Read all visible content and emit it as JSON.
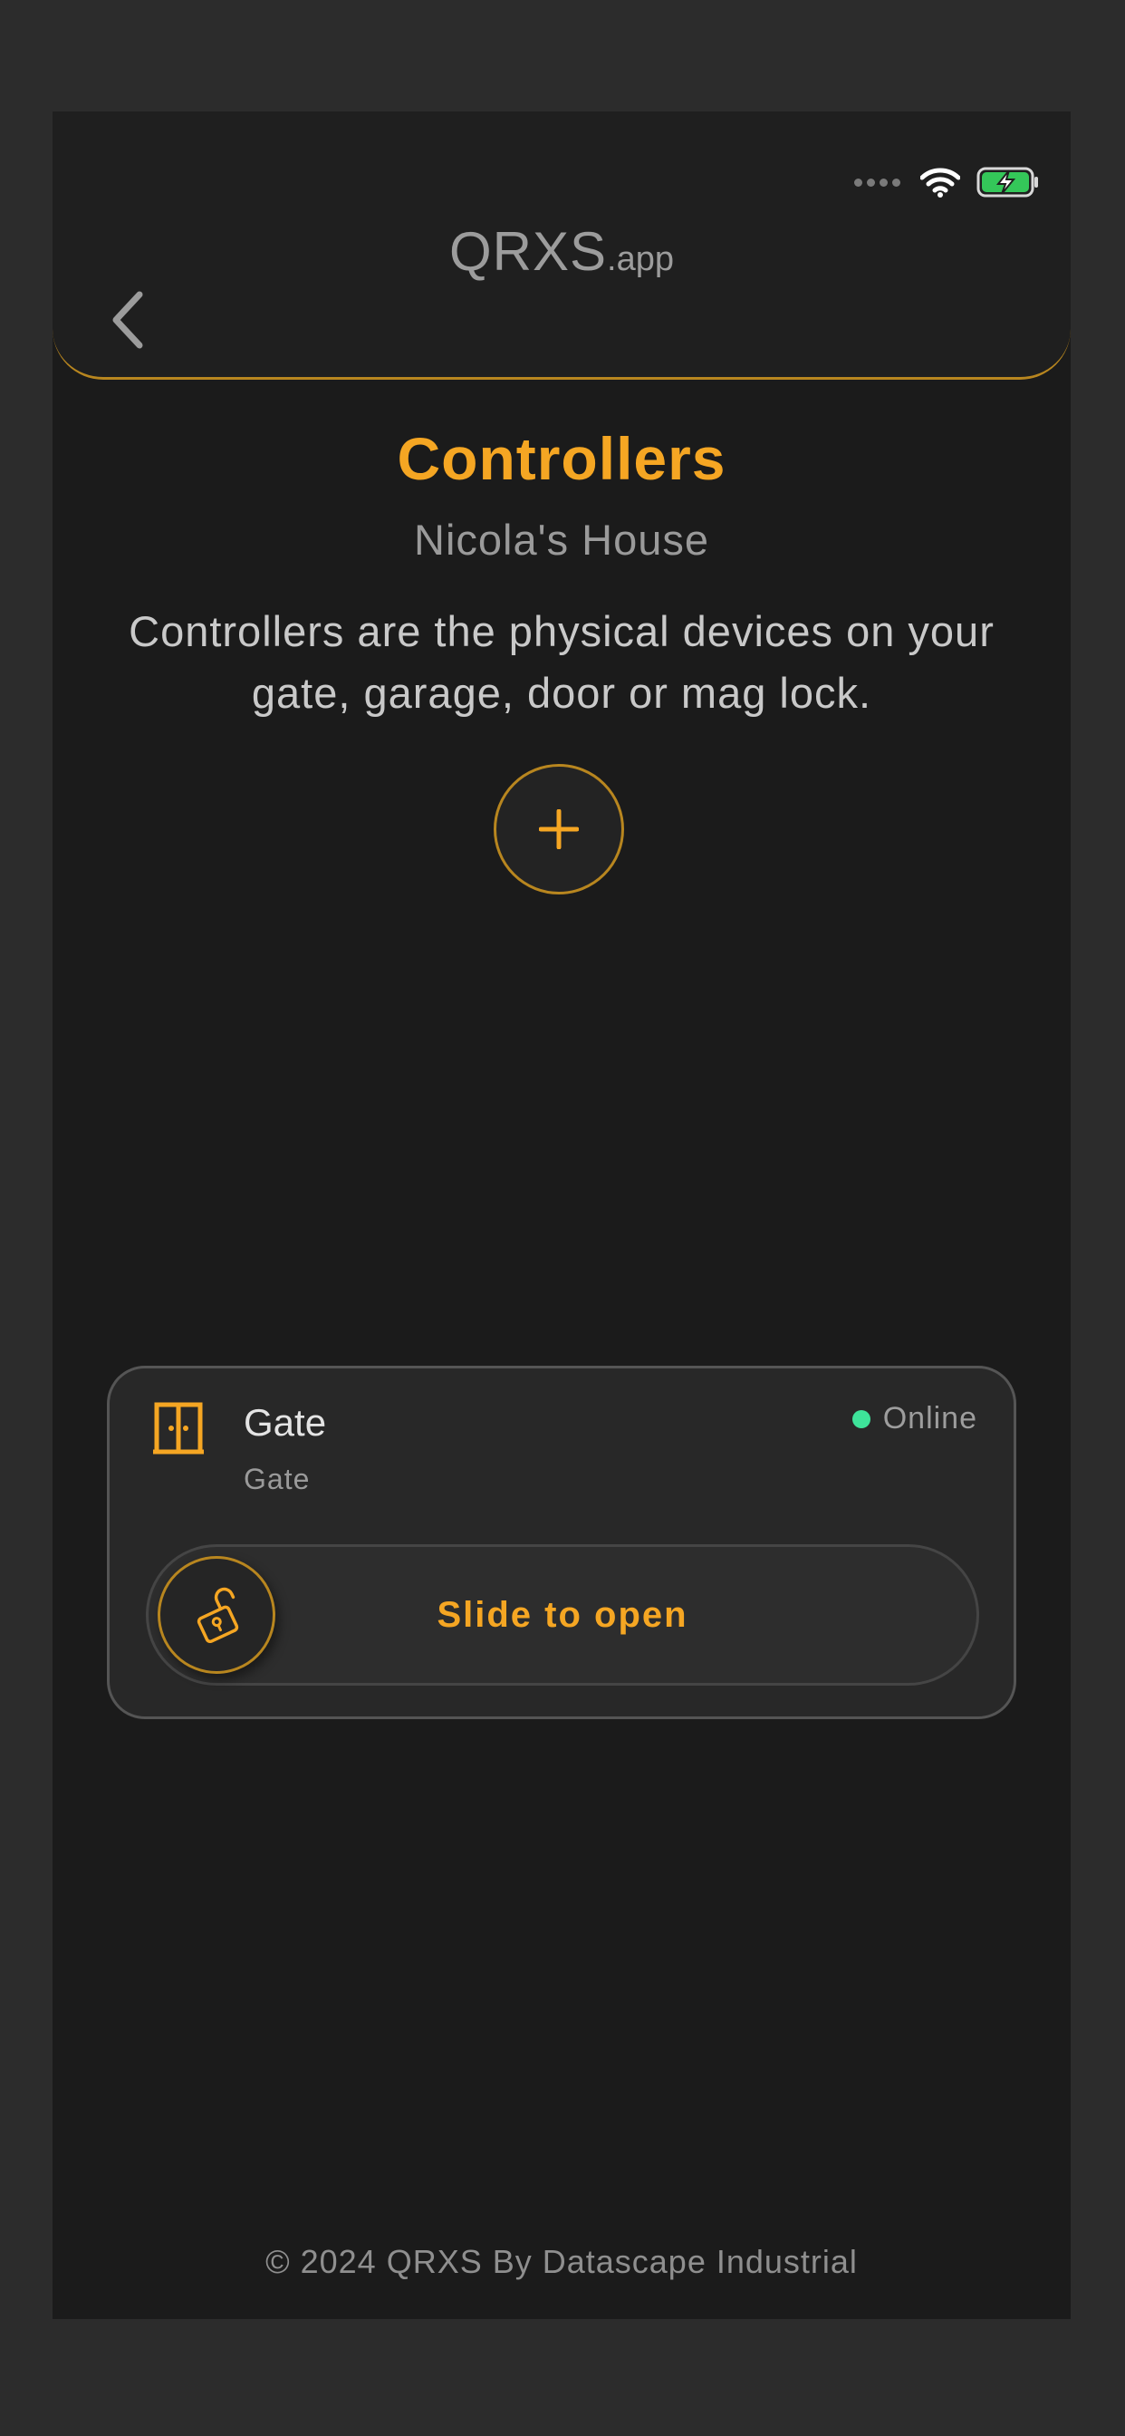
{
  "colors": {
    "accent": "#f5a623",
    "accent_border": "#b8861f",
    "online": "#3ee39a",
    "screen_bg": "#1b1b1b",
    "outer_bg": "#2c2c2c"
  },
  "status_bar": {
    "icons": [
      "signal-dots-icon",
      "wifi-icon",
      "battery-charging-icon"
    ]
  },
  "header": {
    "app_name": "QRXS",
    "app_suffix": ".app",
    "back_icon": "chevron-left-icon"
  },
  "page": {
    "title": "Controllers",
    "house_name": "Nicola's House",
    "description": "Controllers are the physical devices on your gate, garage, door or mag lock.",
    "add_icon": "plus-icon"
  },
  "controllers": [
    {
      "icon": "door-icon",
      "name": "Gate",
      "type": "Gate",
      "status": "Online",
      "slider_label": "Slide to open",
      "slider_icon": "unlock-icon"
    }
  ],
  "footer": {
    "copyright": "© 2024 QRXS By Datascape Industrial"
  }
}
